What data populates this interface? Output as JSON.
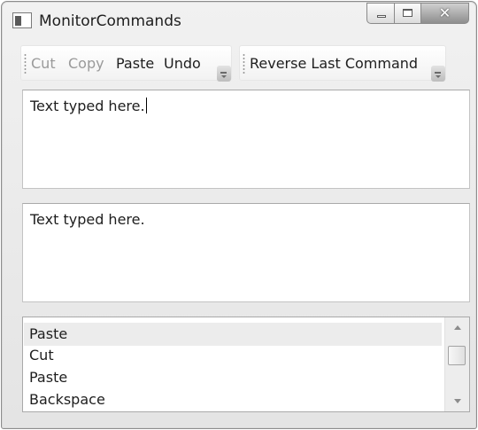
{
  "window": {
    "title": "MonitorCommands"
  },
  "toolbar1": {
    "items": [
      {
        "label": "Cut",
        "enabled": false
      },
      {
        "label": "Copy",
        "enabled": false
      },
      {
        "label": "Paste",
        "enabled": true
      },
      {
        "label": "Undo",
        "enabled": true
      }
    ]
  },
  "toolbar2": {
    "items": [
      {
        "label": "Reverse Last Command",
        "enabled": true
      }
    ]
  },
  "textbox1": {
    "value": "Text typed here."
  },
  "textbox2": {
    "value": "Text typed here."
  },
  "history_list": {
    "items": [
      "Paste",
      "Cut",
      "Paste",
      "Backspace"
    ],
    "selected_index": 0
  },
  "colors": {
    "disabled_text": "#9a9a9a",
    "text": "#1e1e1e",
    "selected_row": "#ececec"
  }
}
